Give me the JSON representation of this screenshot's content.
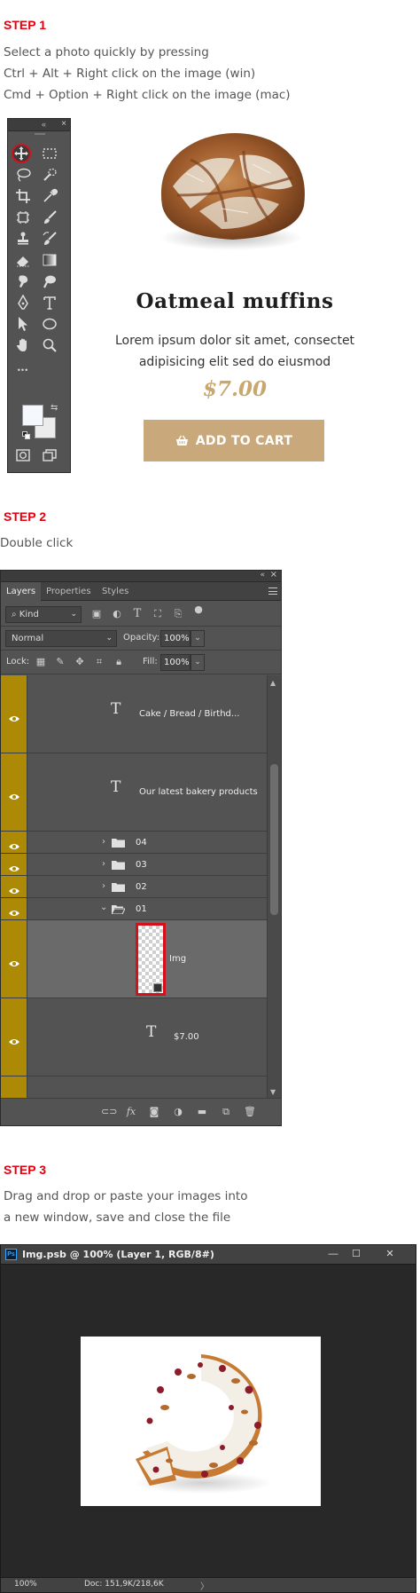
{
  "step1": {
    "title": "STEP 1",
    "lines": [
      "Select a photo quickly by pressing",
      "Ctrl + Alt + Right click on the image (win)",
      "Cmd + Option + Right click on the image (mac)"
    ],
    "toolbar": {
      "collapse": "«",
      "close": "×",
      "more": "•••",
      "tools": [
        "move-tool",
        "marquee-tool",
        "lasso-tool",
        "quick-selection-tool",
        "crop-tool",
        "eyedropper-tool",
        "frame-tool",
        "brush-tool",
        "stamp-tool",
        "history-brush-tool",
        "eraser-tool",
        "gradient-tool",
        "smudge-tool",
        "dodge-tool",
        "pen-tool",
        "type-tool",
        "path-selection-tool",
        "shape-tool",
        "hand-tool",
        "zoom-tool"
      ],
      "foreground_color": "#f5f9fd",
      "background_color": "#ececec"
    },
    "product": {
      "name": "Oatmeal muffins",
      "description_line1": "Lorem ipsum dolor sit amet, consectet",
      "description_line2": "adipisicing elit sed do eiusmod",
      "price": "$7.00",
      "button_label": "ADD TO CART",
      "accent": "#c9a97b"
    }
  },
  "step2": {
    "title": "STEP 2",
    "line": "Double click",
    "panel": {
      "collapse": "«",
      "close": "×",
      "tabs": [
        "Layers",
        "Properties",
        "Styles"
      ],
      "kind_label": "Kind",
      "blend_mode": "Normal",
      "opacity_label": "Opacity:",
      "opacity_value": "100%",
      "lock_label": "Lock:",
      "fill_label": "Fill:",
      "fill_value": "100%",
      "layers": [
        {
          "type": "text",
          "name": "Cake  /  Bread  /  Birthd..."
        },
        {
          "type": "text",
          "name": "Our latest bakery products"
        },
        {
          "type": "group",
          "name": "04",
          "expanded": false
        },
        {
          "type": "group",
          "name": "03",
          "expanded": false
        },
        {
          "type": "group",
          "name": "02",
          "expanded": false
        },
        {
          "type": "group",
          "name": "01",
          "expanded": true
        },
        {
          "type": "smart-object",
          "name": "Img",
          "selected": true
        },
        {
          "type": "text",
          "name": "$7.00"
        }
      ],
      "eye_color": "#ad8a06"
    }
  },
  "step3": {
    "title": "STEP 3",
    "lines": [
      "Drag and drop or paste your images into",
      "a new window, save and close the file"
    ],
    "window": {
      "app_badge": "Ps",
      "title": "Img.psb @ 100% (Layer 1, RGB/8#)",
      "minimize": "—",
      "maximize": "☐",
      "close": "✕",
      "zoom": "100%",
      "doc_info": "Doc: 151,9K/218,6K",
      "status_arrow": "〉"
    }
  }
}
